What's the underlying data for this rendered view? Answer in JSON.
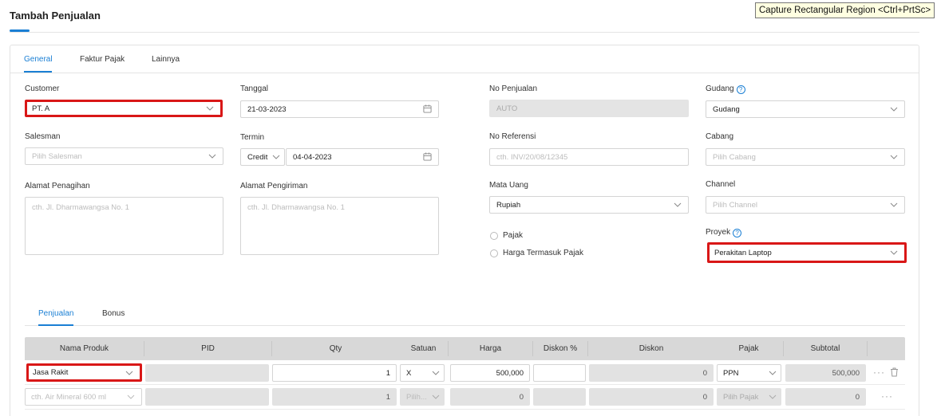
{
  "page": {
    "title": "Tambah Penjualan"
  },
  "tooltip": "Capture Rectangular Region <Ctrl+PrtSc>",
  "tabs": [
    {
      "label": "General",
      "active": true
    },
    {
      "label": "Faktur Pajak",
      "active": false
    },
    {
      "label": "Lainnya",
      "active": false
    }
  ],
  "form": {
    "customer": {
      "label": "Customer",
      "value": "PT. A"
    },
    "salesman": {
      "label": "Salesman",
      "placeholder": "Pilih Salesman"
    },
    "alamat_penagihan": {
      "label": "Alamat Penagihan",
      "placeholder": "cth. Jl. Dharmawangsa No. 1"
    },
    "tanggal": {
      "label": "Tanggal",
      "value": "21-03-2023"
    },
    "termin": {
      "label": "Termin",
      "type": "Credit",
      "date": "04-04-2023"
    },
    "alamat_pengiriman": {
      "label": "Alamat Pengiriman",
      "placeholder": "cth. Jl. Dharmawangsa No. 1"
    },
    "no_penjualan": {
      "label": "No Penjualan",
      "value": "AUTO"
    },
    "no_referensi": {
      "label": "No Referensi",
      "placeholder": "cth. INV/20/08/12345"
    },
    "mata_uang": {
      "label": "Mata Uang",
      "value": "Rupiah"
    },
    "pajak": {
      "label": "Pajak"
    },
    "harga_termasuk_pajak": {
      "label": "Harga Termasuk Pajak"
    },
    "gudang": {
      "label": "Gudang",
      "value": "Gudang"
    },
    "cabang": {
      "label": "Cabang",
      "placeholder": "Pilih Cabang"
    },
    "channel": {
      "label": "Channel",
      "placeholder": "Pilih Channel"
    },
    "proyek": {
      "label": "Proyek",
      "value": "Perakitan Laptop"
    },
    "help_glyph": "?"
  },
  "subtabs": [
    {
      "label": "Penjualan",
      "active": true
    },
    {
      "label": "Bonus",
      "active": false
    }
  ],
  "table": {
    "columns": [
      "Nama Produk",
      "PID",
      "Qty",
      "Satuan",
      "Harga",
      "Diskon %",
      "Diskon",
      "Pajak",
      "Subtotal"
    ],
    "rows": [
      {
        "produk": "Jasa Rakit",
        "pid": "",
        "qty": "1",
        "satuan": "X",
        "harga": "500,000",
        "diskon_pct": "",
        "diskon": "0",
        "pajak": "PPN",
        "subtotal": "500,000",
        "more": "···"
      },
      {
        "produk": "cth. Air Mineral 600 ml",
        "pid": "",
        "qty": "1",
        "satuan": "Pilih...",
        "harga": "0",
        "diskon_pct": "",
        "diskon": "0",
        "pajak": "Pilih Pajak",
        "subtotal": "0",
        "more": "···"
      }
    ]
  },
  "colors": {
    "accent": "#1a7fd4",
    "highlight": "#d91717"
  }
}
